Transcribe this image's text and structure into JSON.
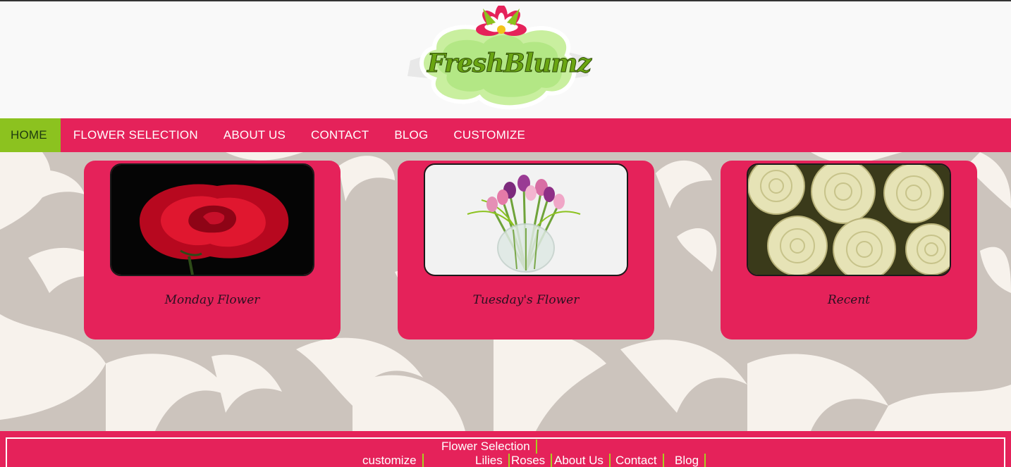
{
  "logo": {
    "text_part1": "FreshBlumz",
    "alt": "FreshBlumz logo"
  },
  "nav": {
    "items": [
      {
        "label": "HOME"
      },
      {
        "label": "FLOWER SELECTION"
      },
      {
        "label": "ABOUT US"
      },
      {
        "label": "CONTACT"
      },
      {
        "label": "BLOG"
      },
      {
        "label": "CUSTOMIZE"
      }
    ],
    "active": "HOME"
  },
  "cards": [
    {
      "caption": "Monday Flower",
      "image": "red-rose-photo"
    },
    {
      "caption": "Tuesday's Flower",
      "image": "tulips-vase-photo"
    },
    {
      "caption": "Recent",
      "image": "white-roses-photo"
    }
  ],
  "footer": {
    "row1": [
      {
        "label": "Flower Selection"
      }
    ],
    "row2": [
      {
        "label": "customize"
      },
      {
        "label": "Lilies"
      },
      {
        "label": "Roses"
      },
      {
        "label": "About Us"
      },
      {
        "label": "Contact"
      },
      {
        "label": "Blog"
      }
    ]
  },
  "colors": {
    "brand_pink": "#e5225a",
    "active_green": "#8cc21f",
    "background_beige": "#ccc4bd",
    "swirl_cream": "#f7f2ec"
  }
}
